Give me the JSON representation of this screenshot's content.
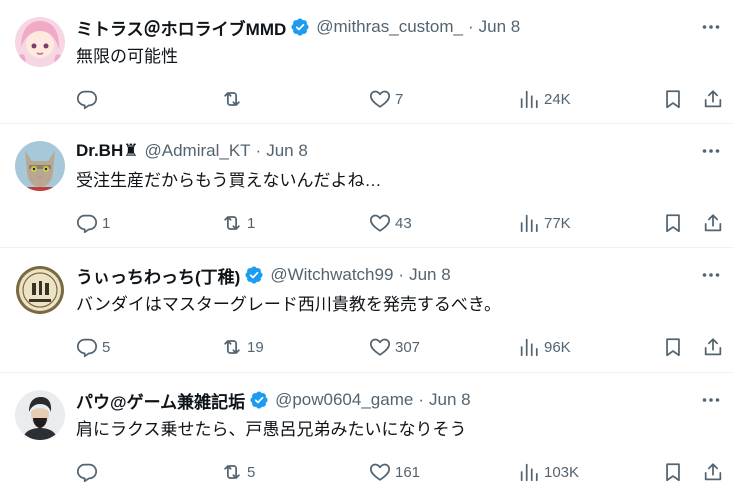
{
  "tweets": [
    {
      "name": "ミトラス＠ホロライブMMD",
      "verified": true,
      "handle": "@mithras_custom_",
      "separator": "·",
      "date": "Jun 8",
      "text": "無限の可能性",
      "replies": "",
      "retweets": "",
      "likes": "7",
      "views": "24K"
    },
    {
      "name": "Dr.BH♜",
      "verified": false,
      "handle": "@Admiral_KT",
      "separator": "·",
      "date": "Jun 8",
      "text": "受注生産だからもう買えないんだよね…",
      "replies": "1",
      "retweets": "1",
      "likes": "43",
      "views": "77K"
    },
    {
      "name": "うぃっちわっち(丁稚)",
      "verified": true,
      "handle": "@Witchwatch99",
      "separator": "·",
      "date": "Jun 8",
      "text": "バンダイはマスターグレード西川貴教を発売するべき。",
      "replies": "5",
      "retweets": "19",
      "likes": "307",
      "views": "96K"
    },
    {
      "name": "パウ@ゲーム兼雑記垢",
      "verified": true,
      "handle": "@pow0604_game",
      "separator": "·",
      "date": "Jun 8",
      "text": "肩にラクス乗せたら、戸愚呂兄弟みたいになりそう",
      "replies": "",
      "retweets": "5",
      "likes": "161",
      "views": "103K"
    }
  ],
  "colors": {
    "text": "#0f1419",
    "muted": "#536471",
    "verified": "#1d9bf0",
    "divider": "#eff3f4"
  },
  "icons": [
    "avatar",
    "verified-badge-icon",
    "more-icon",
    "reply-icon",
    "retweet-icon",
    "like-icon",
    "views-icon",
    "bookmark-icon",
    "share-icon"
  ]
}
